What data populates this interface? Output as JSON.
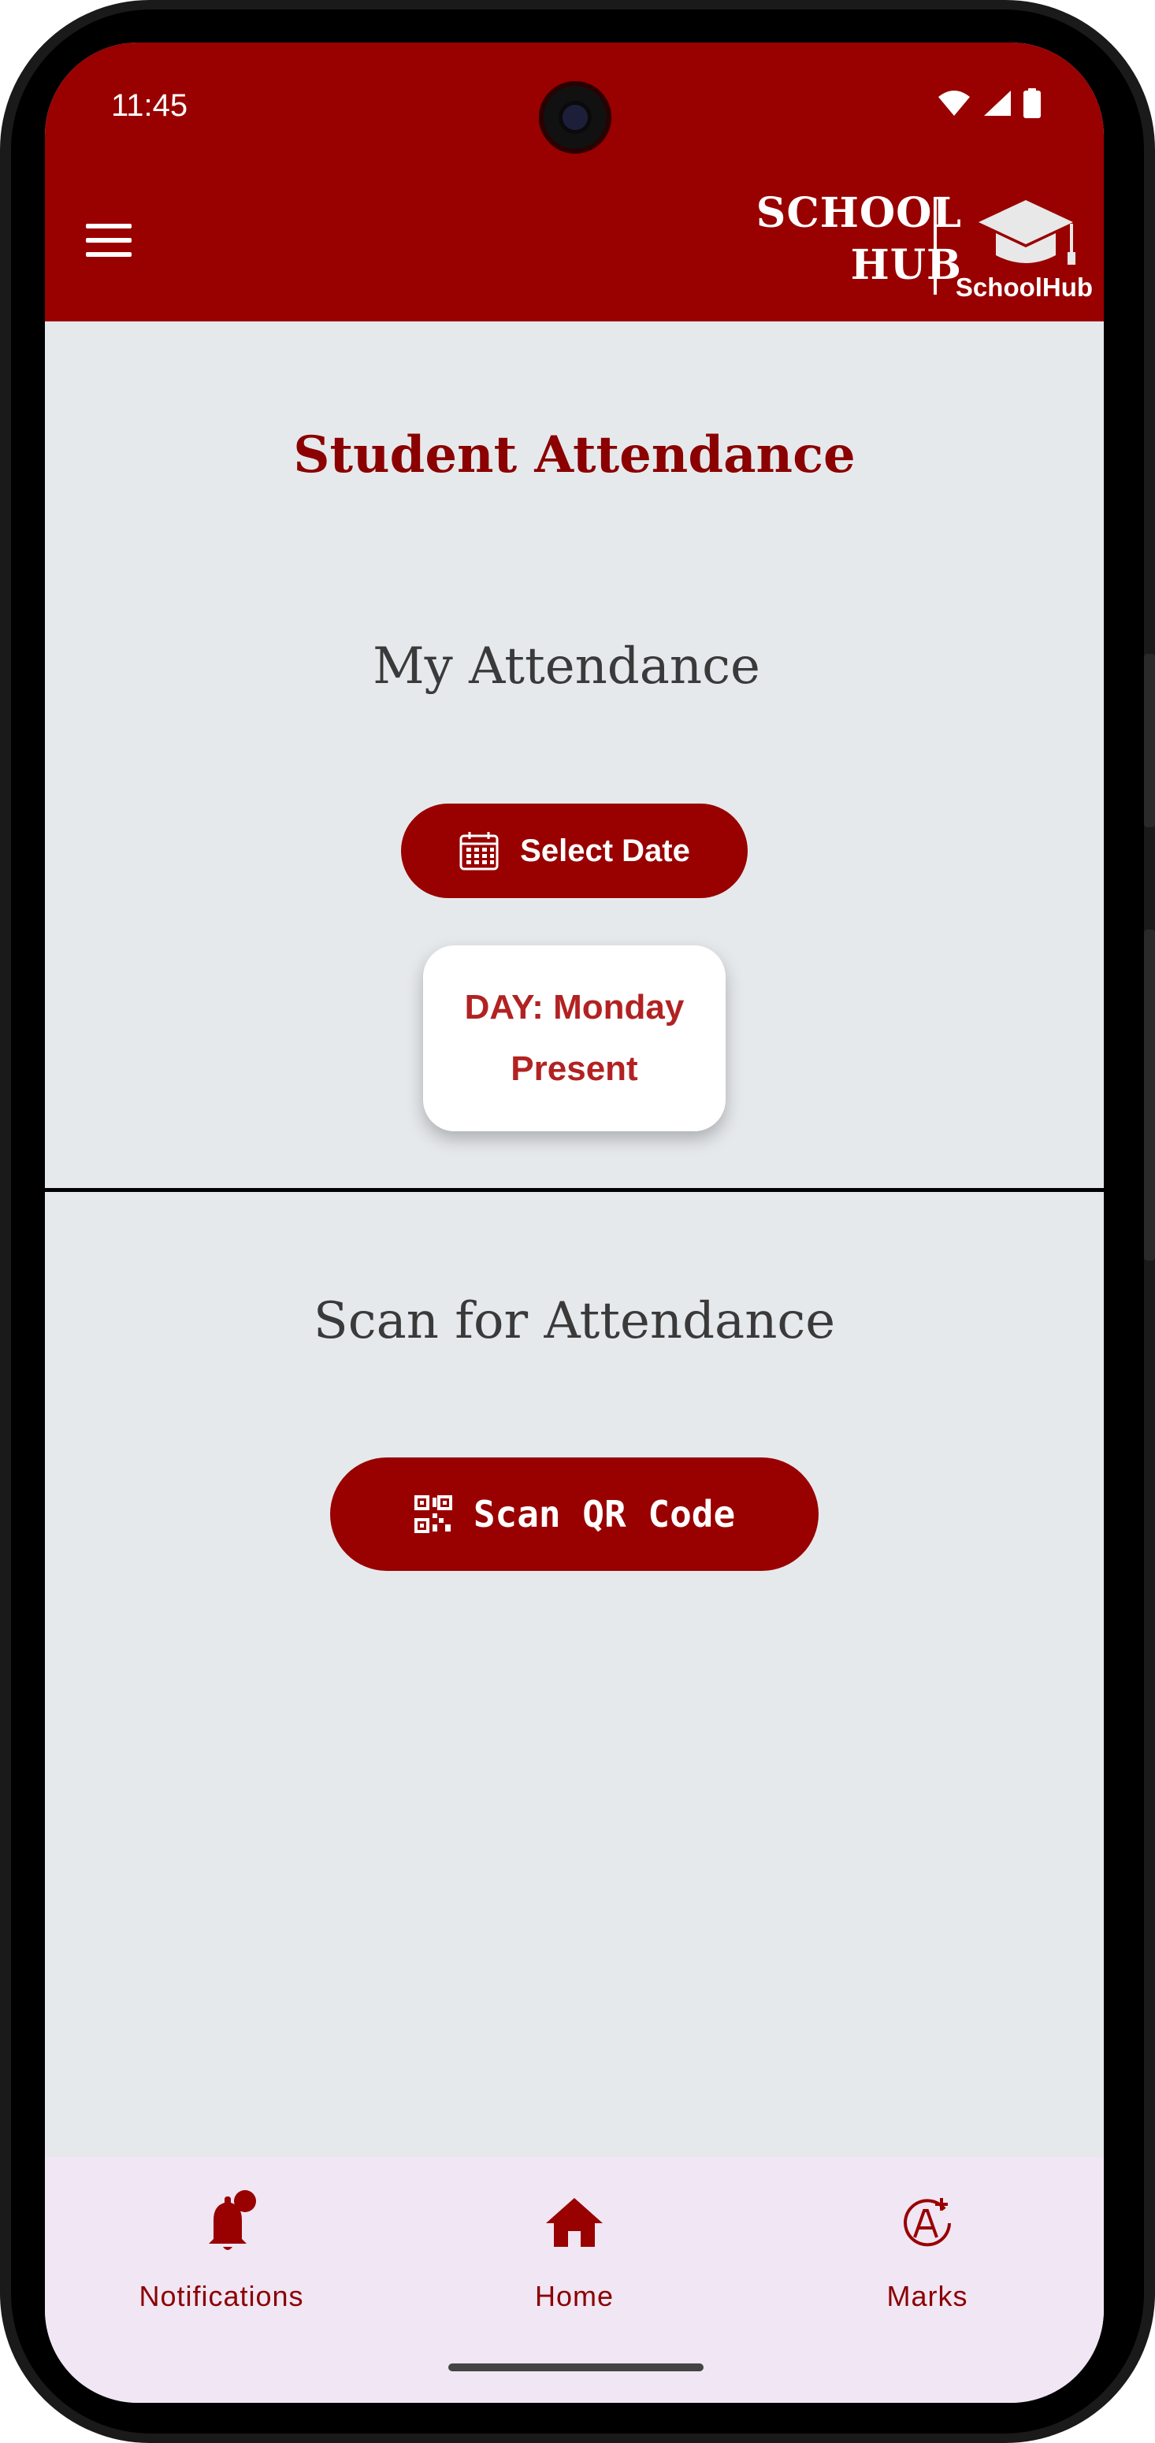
{
  "status_bar": {
    "time": "11:45"
  },
  "app_bar": {
    "brand_line1": "SCHOOL",
    "brand_line2": "HUB",
    "logo_label": "SchoolHub",
    "color": "#990000"
  },
  "page": {
    "title": "Student Attendance"
  },
  "my_attendance": {
    "heading": "My Attendance",
    "select_date_label": "Select Date",
    "day_line": "DAY: Monday",
    "status_line": "Present"
  },
  "scan": {
    "heading": "Scan for Attendance",
    "button_label": "Scan QR Code"
  },
  "bottom_nav": {
    "items": [
      {
        "label": "Notifications",
        "icon": "bell-badge-icon"
      },
      {
        "label": "Home",
        "icon": "home-icon"
      },
      {
        "label": "Marks",
        "icon": "grade-a-plus-icon"
      }
    ]
  },
  "colors": {
    "primary": "#990000",
    "accent_text": "#b22222",
    "background": "#e6e9ec",
    "nav_background": "#f0e6f4"
  }
}
